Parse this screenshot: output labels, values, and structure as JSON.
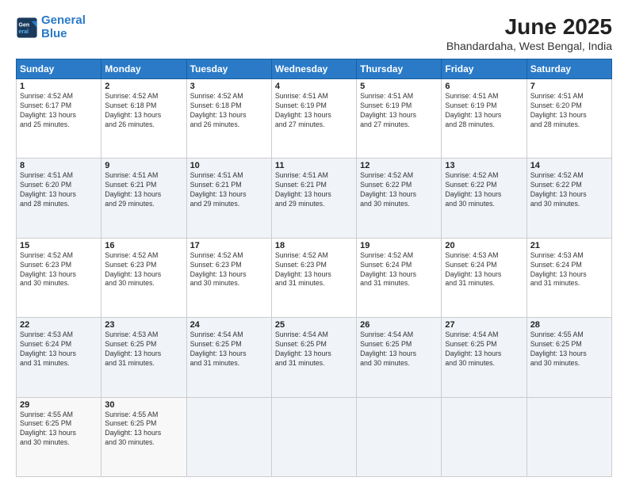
{
  "logo": {
    "line1": "General",
    "line2": "Blue"
  },
  "title": "June 2025",
  "subtitle": "Bhandardaha, West Bengal, India",
  "headers": [
    "Sunday",
    "Monday",
    "Tuesday",
    "Wednesday",
    "Thursday",
    "Friday",
    "Saturday"
  ],
  "weeks": [
    [
      {
        "day": "1",
        "sunrise": "4:52 AM",
        "sunset": "6:17 PM",
        "daylight": "13 hours and 25 minutes."
      },
      {
        "day": "2",
        "sunrise": "4:52 AM",
        "sunset": "6:18 PM",
        "daylight": "13 hours and 26 minutes."
      },
      {
        "day": "3",
        "sunrise": "4:52 AM",
        "sunset": "6:18 PM",
        "daylight": "13 hours and 26 minutes."
      },
      {
        "day": "4",
        "sunrise": "4:51 AM",
        "sunset": "6:19 PM",
        "daylight": "13 hours and 27 minutes."
      },
      {
        "day": "5",
        "sunrise": "4:51 AM",
        "sunset": "6:19 PM",
        "daylight": "13 hours and 27 minutes."
      },
      {
        "day": "6",
        "sunrise": "4:51 AM",
        "sunset": "6:19 PM",
        "daylight": "13 hours and 28 minutes."
      },
      {
        "day": "7",
        "sunrise": "4:51 AM",
        "sunset": "6:20 PM",
        "daylight": "13 hours and 28 minutes."
      }
    ],
    [
      {
        "day": "8",
        "sunrise": "4:51 AM",
        "sunset": "6:20 PM",
        "daylight": "13 hours and 28 minutes."
      },
      {
        "day": "9",
        "sunrise": "4:51 AM",
        "sunset": "6:21 PM",
        "daylight": "13 hours and 29 minutes."
      },
      {
        "day": "10",
        "sunrise": "4:51 AM",
        "sunset": "6:21 PM",
        "daylight": "13 hours and 29 minutes."
      },
      {
        "day": "11",
        "sunrise": "4:51 AM",
        "sunset": "6:21 PM",
        "daylight": "13 hours and 29 minutes."
      },
      {
        "day": "12",
        "sunrise": "4:52 AM",
        "sunset": "6:22 PM",
        "daylight": "13 hours and 30 minutes."
      },
      {
        "day": "13",
        "sunrise": "4:52 AM",
        "sunset": "6:22 PM",
        "daylight": "13 hours and 30 minutes."
      },
      {
        "day": "14",
        "sunrise": "4:52 AM",
        "sunset": "6:22 PM",
        "daylight": "13 hours and 30 minutes."
      }
    ],
    [
      {
        "day": "15",
        "sunrise": "4:52 AM",
        "sunset": "6:23 PM",
        "daylight": "13 hours and 30 minutes."
      },
      {
        "day": "16",
        "sunrise": "4:52 AM",
        "sunset": "6:23 PM",
        "daylight": "13 hours and 30 minutes."
      },
      {
        "day": "17",
        "sunrise": "4:52 AM",
        "sunset": "6:23 PM",
        "daylight": "13 hours and 30 minutes."
      },
      {
        "day": "18",
        "sunrise": "4:52 AM",
        "sunset": "6:23 PM",
        "daylight": "13 hours and 31 minutes."
      },
      {
        "day": "19",
        "sunrise": "4:52 AM",
        "sunset": "6:24 PM",
        "daylight": "13 hours and 31 minutes."
      },
      {
        "day": "20",
        "sunrise": "4:53 AM",
        "sunset": "6:24 PM",
        "daylight": "13 hours and 31 minutes."
      },
      {
        "day": "21",
        "sunrise": "4:53 AM",
        "sunset": "6:24 PM",
        "daylight": "13 hours and 31 minutes."
      }
    ],
    [
      {
        "day": "22",
        "sunrise": "4:53 AM",
        "sunset": "6:24 PM",
        "daylight": "13 hours and 31 minutes."
      },
      {
        "day": "23",
        "sunrise": "4:53 AM",
        "sunset": "6:25 PM",
        "daylight": "13 hours and 31 minutes."
      },
      {
        "day": "24",
        "sunrise": "4:54 AM",
        "sunset": "6:25 PM",
        "daylight": "13 hours and 31 minutes."
      },
      {
        "day": "25",
        "sunrise": "4:54 AM",
        "sunset": "6:25 PM",
        "daylight": "13 hours and 31 minutes."
      },
      {
        "day": "26",
        "sunrise": "4:54 AM",
        "sunset": "6:25 PM",
        "daylight": "13 hours and 30 minutes."
      },
      {
        "day": "27",
        "sunrise": "4:54 AM",
        "sunset": "6:25 PM",
        "daylight": "13 hours and 30 minutes."
      },
      {
        "day": "28",
        "sunrise": "4:55 AM",
        "sunset": "6:25 PM",
        "daylight": "13 hours and 30 minutes."
      }
    ],
    [
      {
        "day": "29",
        "sunrise": "4:55 AM",
        "sunset": "6:25 PM",
        "daylight": "13 hours and 30 minutes."
      },
      {
        "day": "30",
        "sunrise": "4:55 AM",
        "sunset": "6:25 PM",
        "daylight": "13 hours and 30 minutes."
      },
      null,
      null,
      null,
      null,
      null
    ]
  ],
  "labels": {
    "sunrise": "Sunrise:",
    "sunset": "Sunset:",
    "daylight": "Daylight:"
  }
}
